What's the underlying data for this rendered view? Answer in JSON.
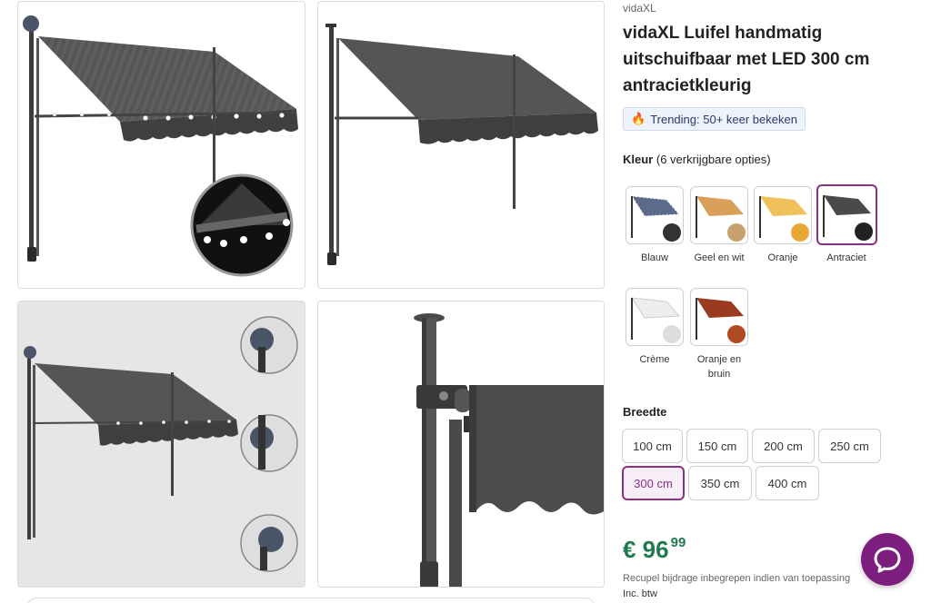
{
  "product": {
    "brand": "vidaXL",
    "title": "vidaXL Luifel handmatig uitschuifbaar met LED 300 cm antracietkleurig",
    "trending": "Trending: 50+ keer bekeken"
  },
  "colors": {
    "label": "Kleur",
    "note": "(6 verkrijgbare opties)",
    "options": [
      {
        "label": "Blauw",
        "stripe": "#5a6b8c",
        "selected": false
      },
      {
        "label": "Geel en wit",
        "stripe": "#d9a05a",
        "selected": false
      },
      {
        "label": "Oranje",
        "stripe": "#f0c05a",
        "selected": false
      },
      {
        "label": "Antraciet",
        "stripe": "#4a4a4a",
        "selected": true
      },
      {
        "label": "Crème",
        "stripe": "#eeeeee",
        "selected": false
      },
      {
        "label": "Oranje en bruin",
        "stripe": "#9a3a1e",
        "selected": false
      }
    ]
  },
  "width": {
    "label": "Breedte",
    "options": [
      "100 cm",
      "150 cm",
      "200 cm",
      "250 cm",
      "300 cm",
      "350 cm",
      "400 cm"
    ],
    "selected": "300 cm"
  },
  "price": {
    "main": "€ 96",
    "cents": "99",
    "recupel": "Recupel bijdrage inbegrepen indien van toepassing",
    "btw": "Inc. btw"
  },
  "theme": {
    "accent": "#8a2f86",
    "price_color": "#1f7a4f",
    "chat_color": "#7d1d7e"
  },
  "icons": {
    "trending": "flame-icon",
    "chat": "chat-bubble-icon"
  }
}
